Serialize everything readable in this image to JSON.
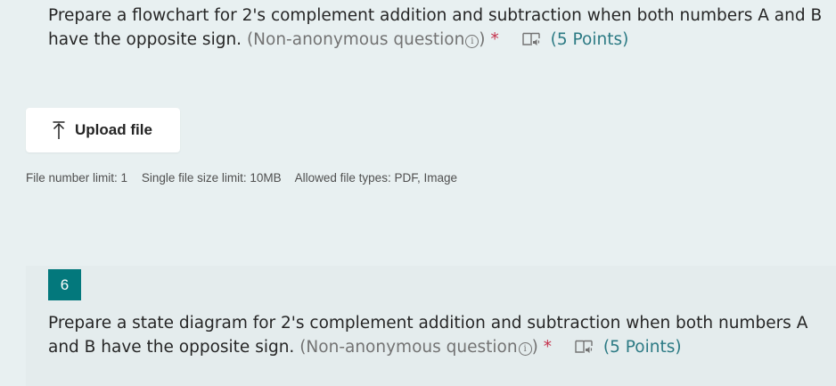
{
  "question5": {
    "text_line1": "Prepare a flowchart for 2's complement addition and subtraction when both numbers A and B",
    "text_line2": "have the opposite sign.",
    "meta_label": "(Non-anonymous question",
    "info_symbol": "i",
    "meta_close": ")",
    "required_mark": "*",
    "points": "(5 Points)"
  },
  "upload": {
    "button_label": "Upload file",
    "file_number_limit": "File number limit: 1",
    "file_size_limit": "Single file size limit: 10MB",
    "allowed_types": "Allowed file types: PDF, Image"
  },
  "question6": {
    "number": "6",
    "text_line1": "Prepare a state diagram for 2's complement addition and subtraction when both numbers A",
    "text_line2": "and B have the opposite sign.",
    "meta_label": "(Non-anonymous question",
    "info_symbol": "i",
    "meta_close": ")",
    "required_mark": "*",
    "points": "(5 Points)"
  },
  "colors": {
    "background": "#e8f0f1",
    "accent": "#03787c",
    "points": "#2c7a84",
    "required": "#c4314b"
  },
  "icons": {
    "immersive_reader": "immersive-reader-icon",
    "upload": "upload-arrow-icon",
    "info": "info-icon"
  }
}
